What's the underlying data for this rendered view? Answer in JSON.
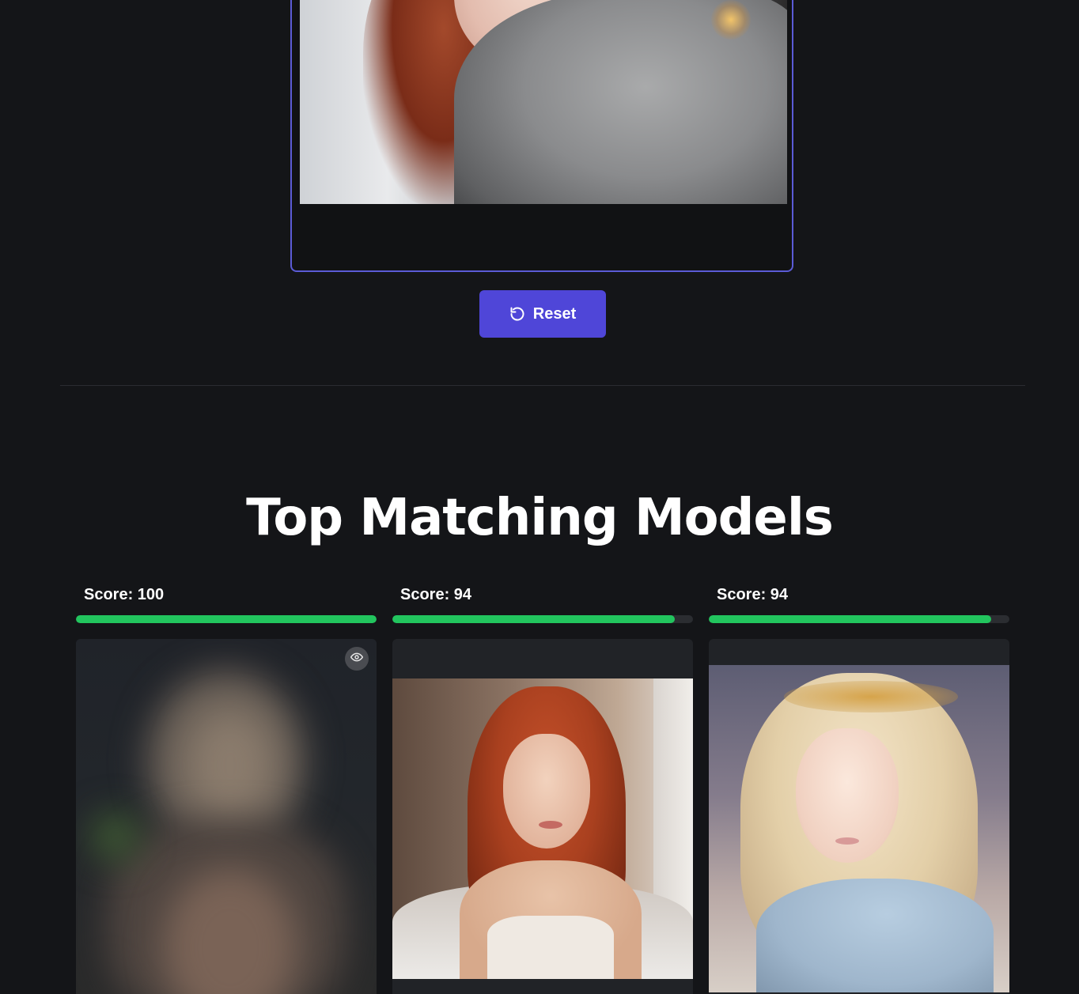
{
  "upload": {
    "preview_alt": "Uploaded reference photo"
  },
  "actions": {
    "reset_label": "Reset",
    "accent_color": "#4f46d8"
  },
  "results": {
    "title": "Top Matching Models",
    "bar_color": "#22c55e",
    "models": [
      {
        "score_label": "Score: 100",
        "score": 100,
        "blurred": true
      },
      {
        "score_label": "Score: 94",
        "score": 94,
        "blurred": false
      },
      {
        "score_label": "Score: 94",
        "score": 94,
        "blurred": false
      }
    ]
  }
}
